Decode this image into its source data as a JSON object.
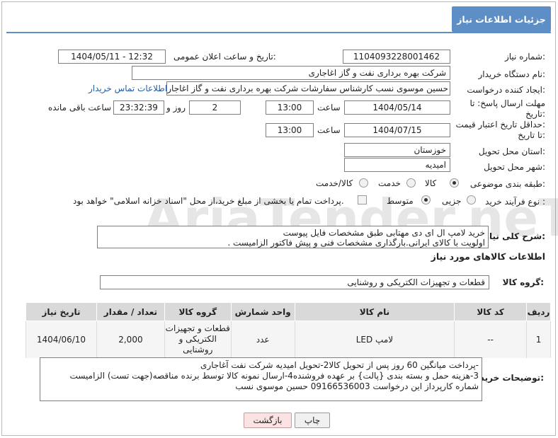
{
  "page": {
    "title": "جزئیات اطلاعات نیاز"
  },
  "fields": {
    "need_number_label": "شماره نیاز:",
    "need_number": "1104093228001462",
    "announce_label": "تاریخ و ساعت اعلان عمومی:",
    "announce_value": "1404/05/11 - 12:32",
    "buyer_org_label": "نام دستگاه خریدار:",
    "buyer_org": "شرکت بهره برداری نفت و گاز اغاجاری",
    "creator_label": "ایجاد کننده درخواست:",
    "creator": "حسین موسوی نسب کارشناس سفارشات شرکت بهره برداری نفت و گاز اغاجار",
    "contact_link": "اطلاعات تماس خریدار",
    "send_deadline_label_1": "مهلت ارسال پاسخ: تا",
    "send_deadline_label_2": "تاریخ:",
    "send_date": "1404/05/14",
    "time_label": "ساعت",
    "send_time": "13:00",
    "days_value": "2",
    "days_label": "روز و",
    "remaining_value": "23:32:39",
    "remaining_label": "ساعت باقی مانده",
    "price_validity_label_1": "حداقل تاریخ اعتبار قیمت:",
    "price_validity_label_2": "تا تاریخ:",
    "price_date": "1404/07/15",
    "price_time": "13:00",
    "province_label": "استان محل تحویل:",
    "province": "خوزستان",
    "city_label": "شهر محل تحویل:",
    "city": "امیدیه",
    "category_label": "طبقه بندی موضوعی:",
    "category_options": [
      "کالا",
      "خدمت",
      "کالا/خدمت"
    ],
    "process_label": "نوع فرآیند خرید :",
    "process_options": [
      "جزیی",
      "متوسط"
    ],
    "payment_note": "پرداخت تمام یا بخشی از مبلغ خرید،از محل \"اسناد خزانه اسلامی\" خواهد بود."
  },
  "description": {
    "label": "شرح کلی نیاز:",
    "line1": "خرید لامپ ال ای دی مهتابی طبق مشخصات فایل پیوست",
    "line2": "اولویت با کالای ایرانی.بارگذاری مشخصات فنی و پیش فاکتور الزامیست ."
  },
  "goods_section": {
    "title": "اطلاعات کالاهای مورد نیاز",
    "group_label": "گروه کالا:",
    "group_value": "قطعات و تجهیزات الکتریکی و روشنایی"
  },
  "table": {
    "headers": [
      "ردیف",
      "کد کالا",
      "نام کالا",
      "واحد شمارش",
      "گروه کالا",
      "تعداد / مقدار",
      "تاریخ نیاز"
    ],
    "rows": [
      {
        "row": "1",
        "code": "--",
        "name": "لامپ LED",
        "unit": "عدد",
        "group_l1": "قطعات و تجهیزات",
        "group_l2": "الکتریکی و",
        "group_l3": "روشنایی",
        "qty": "2,000",
        "date": "1404/06/10"
      }
    ]
  },
  "buyer_notes": {
    "label": "توضیحات خریدار:",
    "line1": "-پرداخت میانگین 60 روز پس از تحویل کالا2-تحویل امیدیه شرکت نفت آغاجاری",
    "line2": "3-هزینه حمل  و بسته بندی {پالت} بر عهده فروشنده4-ارسال نمونه کالا توسط برنده مناقصه(جهت تست) الزامیست",
    "line3": "شماره کارپرداز این درخواست 09166536003 حسین موسوی نسب"
  },
  "buttons": {
    "print": "چاپ",
    "back": "بازگشت"
  },
  "watermark_text": "AriaTender.neT"
}
